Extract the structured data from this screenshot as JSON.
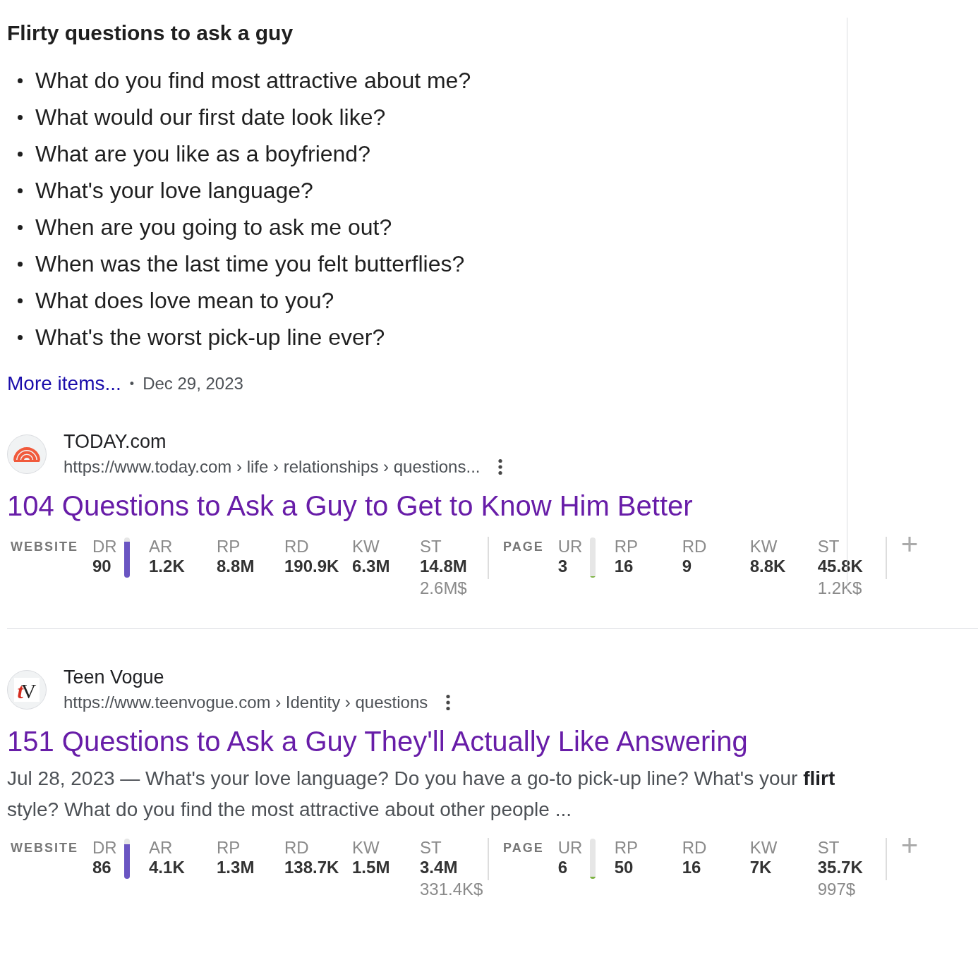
{
  "featured_snippet": {
    "heading": "Flirty questions to ask a guy",
    "items": [
      "What do you find most attractive about me?",
      "What would our first date look like?",
      "What are you like as a boyfriend?",
      "What's your love language?",
      "When are you going to ask me out?",
      "When was the last time you felt butterflies?",
      "What does love mean to you?",
      "What's the worst pick-up line ever?"
    ],
    "more_link": "More items...",
    "separator": "•",
    "date": "Dec 29, 2023"
  },
  "results": [
    {
      "favicon": {
        "kind": "rainbow"
      },
      "site_name": "TODAY.com",
      "url": "https://www.today.com › life › relationships › questions...",
      "title": "104 Questions to Ask a Guy to Get to Know Him Better",
      "metrics": [
        {
          "label": "WEBSITE",
          "cells": [
            {
              "kind": "gauge",
              "label": "DR",
              "value": "90",
              "level": 0.9,
              "color": "#6a55c2"
            },
            {
              "kind": "stat",
              "label": "AR",
              "value": "1.2K"
            },
            {
              "kind": "stat",
              "label": "RP",
              "value": "8.8M"
            },
            {
              "kind": "stat",
              "label": "RD",
              "value": "190.9K"
            },
            {
              "kind": "stat",
              "label": "KW",
              "value": "6.3M"
            },
            {
              "kind": "stat",
              "label": "ST",
              "value": "14.8M",
              "sub": "2.6M$"
            }
          ]
        },
        {
          "label": "PAGE",
          "cells": [
            {
              "kind": "gauge",
              "label": "UR",
              "value": "3",
              "level": 0.03,
              "color": "#7cb342"
            },
            {
              "kind": "stat",
              "label": "RP",
              "value": "16"
            },
            {
              "kind": "stat",
              "label": "RD",
              "value": "9"
            },
            {
              "kind": "stat",
              "label": "KW",
              "value": "8.8K"
            },
            {
              "kind": "stat",
              "label": "ST",
              "value": "45.8K",
              "sub": "1.2K$"
            }
          ]
        }
      ],
      "add_button": "+"
    },
    {
      "favicon": {
        "kind": "letters",
        "letters": [
          "t",
          "V"
        ]
      },
      "site_name": "Teen Vogue",
      "url": "https://www.teenvogue.com › Identity › questions",
      "title": "151 Questions to Ask a Guy They'll Actually Like Answering",
      "snippet": "Jul 28, 2023 — What's your love language? Do you have a go-to pick-up line? What's your **flirt** style? What do you find the most attractive about other people ...",
      "metrics": [
        {
          "label": "WEBSITE",
          "cells": [
            {
              "kind": "gauge",
              "label": "DR",
              "value": "86",
              "level": 0.86,
              "color": "#6a55c2"
            },
            {
              "kind": "stat",
              "label": "AR",
              "value": "4.1K"
            },
            {
              "kind": "stat",
              "label": "RP",
              "value": "1.3M"
            },
            {
              "kind": "stat",
              "label": "RD",
              "value": "138.7K"
            },
            {
              "kind": "stat",
              "label": "KW",
              "value": "1.5M"
            },
            {
              "kind": "stat",
              "label": "ST",
              "value": "3.4M",
              "sub": "331.4K$"
            }
          ]
        },
        {
          "label": "PAGE",
          "cells": [
            {
              "kind": "gauge",
              "label": "UR",
              "value": "6",
              "level": 0.06,
              "color": "#7cb342"
            },
            {
              "kind": "stat",
              "label": "RP",
              "value": "50"
            },
            {
              "kind": "stat",
              "label": "RD",
              "value": "16"
            },
            {
              "kind": "stat",
              "label": "KW",
              "value": "7K"
            },
            {
              "kind": "stat",
              "label": "ST",
              "value": "35.7K",
              "sub": "997$"
            }
          ]
        }
      ],
      "add_button": "+"
    }
  ]
}
